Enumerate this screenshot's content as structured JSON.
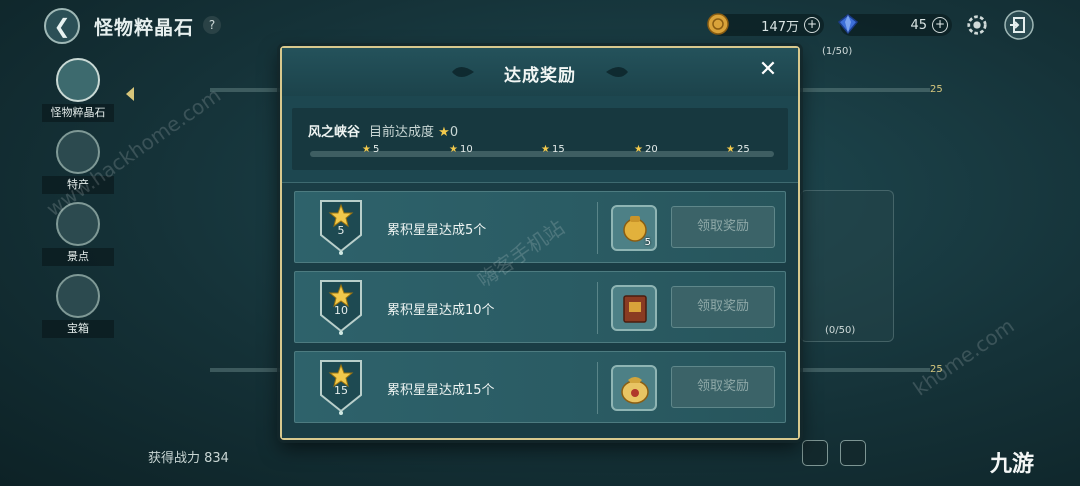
{
  "topbar": {
    "title": "怪物粹晶石",
    "help_icon": "?",
    "gold_amount": "147万",
    "gem_amount": "45",
    "plus_label": "+"
  },
  "sidebar": {
    "items": [
      {
        "label": "怪物粹晶石",
        "active": true
      },
      {
        "label": "特产"
      },
      {
        "label": "景点"
      },
      {
        "label": "宝箱"
      }
    ]
  },
  "background": {
    "card_counter_top": "(1/50)",
    "card_counter_mid": "(0/50)",
    "milestone_25": "25",
    "power_label": "获得战力 834"
  },
  "modal": {
    "title": "达成奖励",
    "close_label": "✕",
    "region_name": "风之峡谷",
    "progress_label": "目前达成度",
    "progress_value": "0",
    "milestones": [
      "5",
      "10",
      "15",
      "20",
      "25"
    ],
    "rewards": [
      {
        "tier": "5",
        "text": "累积星星达成5个",
        "item": "gold-pouch",
        "item_count": "5",
        "button": "领取奖励"
      },
      {
        "tier": "10",
        "text": "累积星星达成10个",
        "item": "book",
        "item_count": "",
        "button": "领取奖励"
      },
      {
        "tier": "15",
        "text": "累积星星达成15个",
        "item": "treasure-bag",
        "item_count": "",
        "button": "领取奖励"
      }
    ]
  },
  "watermarks": {
    "site_left": "www.hackhome.com",
    "site_center": "嗨客手机站",
    "site_right": "khome.com",
    "brand": "九游"
  },
  "colors": {
    "accent_gold": "#d8c98e",
    "star": "#f2c94c",
    "panel": "#1d4750"
  }
}
